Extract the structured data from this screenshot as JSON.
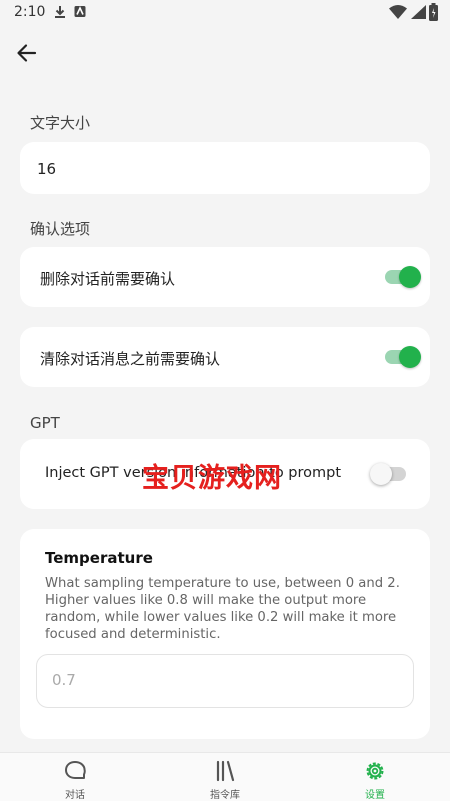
{
  "status_bar": {
    "time": "2:10"
  },
  "font_size_section": {
    "label": "文字大小",
    "value": "16"
  },
  "confirm_section": {
    "label": "确认选项",
    "items": [
      {
        "label": "删除对话前需要确认",
        "enabled": true
      },
      {
        "label": "清除对话消息之前需要确认",
        "enabled": true
      }
    ]
  },
  "gpt_section": {
    "label": "GPT",
    "inject_label": "Inject GPT version information to prompt",
    "inject_enabled": false
  },
  "watermark": "宝贝游戏网",
  "temperature": {
    "title": "Temperature",
    "description": "What sampling temperature to use, between 0 and 2. Higher values like 0.8 will make the output more random, while lower values like 0.2 will make it more focused and deterministic.",
    "placeholder": "0.7"
  },
  "bottom_nav": {
    "items": [
      {
        "label": "对话",
        "icon": "chat-icon"
      },
      {
        "label": "指令库",
        "icon": "library-icon"
      },
      {
        "label": "设置",
        "icon": "gear-icon",
        "active": true
      }
    ]
  },
  "colors": {
    "accent": "#22b14c",
    "background": "#f4f4f4"
  }
}
